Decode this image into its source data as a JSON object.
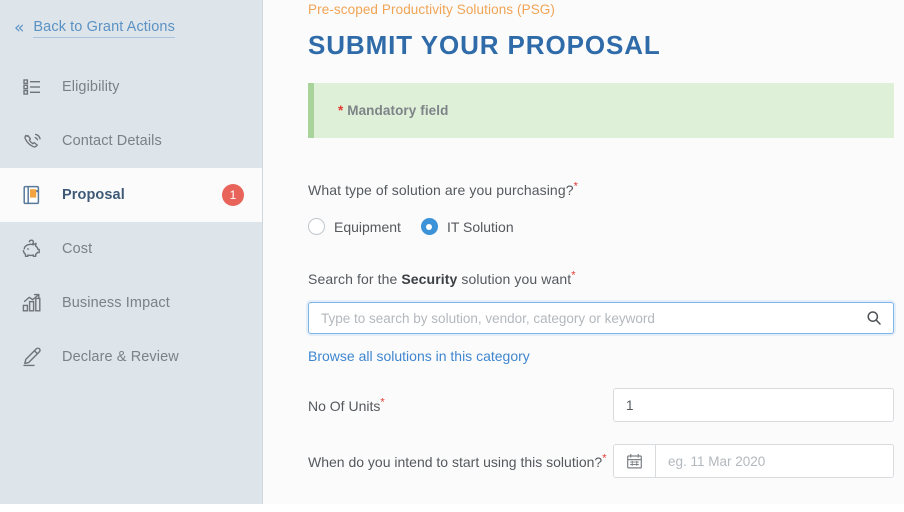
{
  "sidebar": {
    "back_link": {
      "label": "Back to Grant Actions",
      "icon": "double-chevron-left-icon"
    },
    "items": [
      {
        "label": "Eligibility",
        "icon": "list-icon",
        "active": false,
        "badge": ""
      },
      {
        "label": "Contact Details",
        "icon": "phone-icon",
        "active": false,
        "badge": ""
      },
      {
        "label": "Proposal",
        "icon": "notebook-icon",
        "active": true,
        "badge": "1"
      },
      {
        "label": "Cost",
        "icon": "piggy-bank-icon",
        "active": false,
        "badge": ""
      },
      {
        "label": "Business Impact",
        "icon": "bar-chart-icon",
        "active": false,
        "badge": ""
      },
      {
        "label": "Declare & Review",
        "icon": "pen-icon",
        "active": false,
        "badge": ""
      }
    ]
  },
  "main": {
    "eyebrow": "Pre-scoped Productivity Solutions (PSG)",
    "title": "SUBMIT YOUR PROPOSAL",
    "alert": {
      "marker": "*",
      "text": "Mandatory field"
    },
    "question_solution_type": {
      "label": "What type of solution are you purchasing?",
      "required_marker": "*",
      "options": [
        {
          "label": "Equipment",
          "selected": false
        },
        {
          "label": "IT Solution",
          "selected": true
        }
      ]
    },
    "search_section": {
      "label_before": "Search for the ",
      "label_strong": "Security",
      "label_after": " solution you want",
      "required_marker": "*",
      "placeholder": "Type to search by solution, vendor, category or keyword",
      "value": "",
      "search_icon": "search-icon",
      "browse_link": "Browse all solutions in this category"
    },
    "units_field": {
      "label": "No Of Units",
      "required_marker": "*",
      "value": "1"
    },
    "start_date_field": {
      "label": "When do you intend to start using this solution?",
      "required_marker": "*",
      "placeholder": "eg. 11 Mar 2020",
      "value": "",
      "calendar_icon": "calendar-icon"
    }
  },
  "colors": {
    "sidebar_bg": "#dde4ea",
    "accent_blue": "#2e6ba8",
    "link_blue": "#3f86cf",
    "eyebrow_orange": "#f0a455",
    "alert_green_bg": "#dff0d8",
    "alert_green_border": "#a8d49c",
    "badge_red": "#e8645a",
    "required_red": "#e23a30"
  }
}
